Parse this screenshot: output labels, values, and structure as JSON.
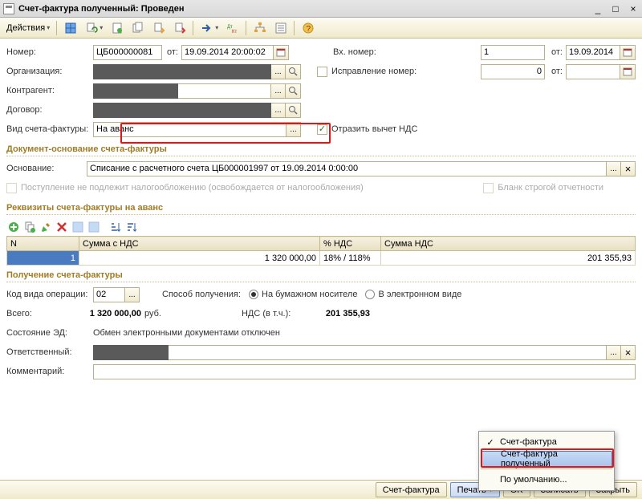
{
  "title": "Счет-фактура полученный: Проведен",
  "actions_label": "Действия",
  "fields": {
    "number_lbl": "Номер:",
    "number_val": "ЦБ000000081",
    "ot": "от:",
    "date_val": "19.09.2014 20:00:02",
    "org_lbl": "Организация:",
    "contragent_lbl": "Контрагент:",
    "dogovor_lbl": "Договор:",
    "vid_lbl": "Вид счета-фактуры:",
    "vid_val": "На аванс",
    "vh_nomer_lbl": "Вх. номер:",
    "vh_nomer_val": "1",
    "vh_date": "19.09.2014",
    "ispr_lbl": "Исправление номер:",
    "ispr_val": "0",
    "otrazit": "Отразить вычет НДС"
  },
  "sec1": "Документ-основание счета-фактуры",
  "osn_lbl": "Основание:",
  "osn_val": "Списание с расчетного счета ЦБ000001997 от 19.09.2014 0:00:00",
  "chk_post": "Поступление не подлежит налогообложению (освобождается от налогообложения)",
  "chk_blank": "Бланк строгой отчетности",
  "sec2": "Реквизиты счета-фактуры на аванс",
  "table": {
    "h1": "N",
    "h2": "Сумма с НДС",
    "h3": "% НДС",
    "h4": "Сумма НДС",
    "r1_n": "1",
    "r1_sum": "1 320 000,00",
    "r1_pct": "18% / 118%",
    "r1_nds": "201 355,93"
  },
  "sec3": "Получение счета-фактуры",
  "kod_lbl": "Код вида операции:",
  "kod_val": "02",
  "sposob_lbl": "Способ получения:",
  "r_bum": "На бумажном носителе",
  "r_el": "В электронном виде",
  "vsego_lbl": "Всего:",
  "vsego_val": "1 320 000,00",
  "rub": "руб.",
  "nds_lbl": "НДС (в т.ч.):",
  "nds_val": "201 355,93",
  "sost_lbl": "Состояние ЭД:",
  "sost_val": "Обмен электронными документами отключен",
  "otv_lbl": "Ответственный:",
  "komm_lbl": "Комментарий:",
  "footer": {
    "sf": "Счет-фактура",
    "pechat": "Печать",
    "ok": "OK",
    "zapisat": "Записать",
    "zakryt": "Закрыть"
  },
  "popup": {
    "i1": "Счет-фактура",
    "i2": "Счет-фактура полученный",
    "i3": "По умолчанию..."
  }
}
